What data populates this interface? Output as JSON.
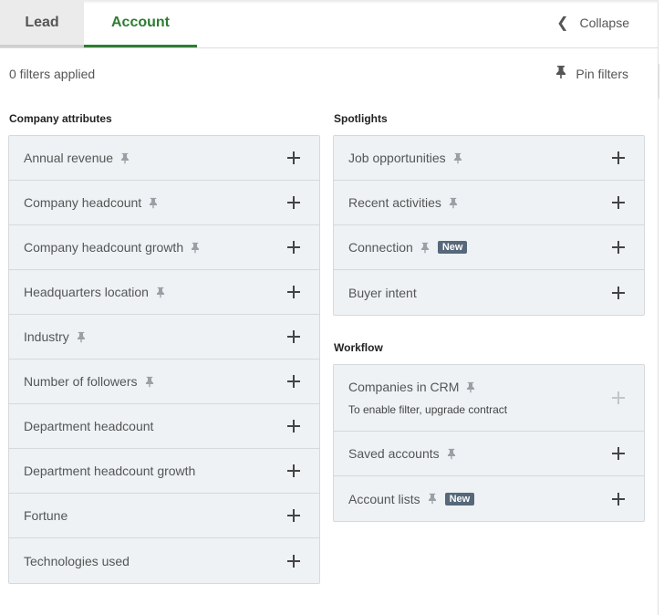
{
  "tabs": {
    "lead": "Lead",
    "account": "Account"
  },
  "header": {
    "collapse_label": "Collapse"
  },
  "toolbar": {
    "filters_count": "0 filters applied",
    "pin_filters_label": "Pin filters"
  },
  "sections": {
    "company_attributes": {
      "title": "Company attributes",
      "items": [
        {
          "label": "Annual revenue",
          "pinned_icon": true
        },
        {
          "label": "Company headcount",
          "pinned_icon": true
        },
        {
          "label": "Company headcount growth",
          "pinned_icon": true
        },
        {
          "label": "Headquarters location",
          "pinned_icon": true
        },
        {
          "label": "Industry",
          "pinned_icon": true
        },
        {
          "label": "Number of followers",
          "pinned_icon": true
        },
        {
          "label": "Department headcount",
          "pinned_icon": false
        },
        {
          "label": "Department headcount growth",
          "pinned_icon": false
        },
        {
          "label": "Fortune",
          "pinned_icon": false
        },
        {
          "label": "Technologies used",
          "pinned_icon": false
        }
      ]
    },
    "spotlights": {
      "title": "Spotlights",
      "items": [
        {
          "label": "Job opportunities",
          "pinned_icon": true
        },
        {
          "label": "Recent activities",
          "pinned_icon": true
        },
        {
          "label": "Connection",
          "pinned_icon": true,
          "badge": "New"
        },
        {
          "label": "Buyer intent",
          "pinned_icon": false
        }
      ]
    },
    "workflow": {
      "title": "Workflow",
      "items": [
        {
          "label": "Companies in CRM",
          "pinned_icon": true,
          "note": "To enable filter, upgrade contract"
        },
        {
          "label": "Saved accounts",
          "pinned_icon": true
        },
        {
          "label": "Account lists",
          "pinned_icon": true,
          "badge": "New"
        }
      ]
    }
  },
  "colors": {
    "accent": "#2e7d32",
    "badge_bg": "#56687a",
    "row_bg": "#eef2f5"
  },
  "icons": {
    "collapse": "chevron-left-icon",
    "pin": "pin-icon",
    "add": "plus-icon"
  }
}
